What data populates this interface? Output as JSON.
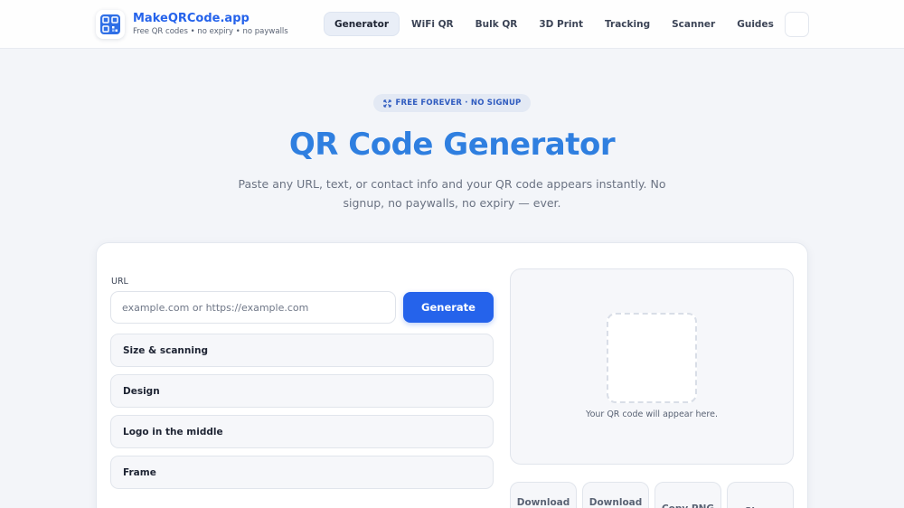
{
  "brand": {
    "name": "MakeQRCode.app",
    "tagline": "Free QR codes • no expiry • no paywalls",
    "logo_icon": "qr-logo-icon"
  },
  "nav": {
    "items": [
      {
        "label": "Generator",
        "active": true
      },
      {
        "label": "WiFi QR"
      },
      {
        "label": "Bulk QR"
      },
      {
        "label": "3D Print"
      },
      {
        "label": "Tracking"
      },
      {
        "label": "Scanner"
      },
      {
        "label": "Guides"
      }
    ]
  },
  "hero": {
    "badge": "FREE FOREVER · NO SIGNUP",
    "badge_icon": "expand-icon",
    "title": "QR Code Generator",
    "subtitle": "Paste any URL, text, or contact info and your QR code appears instantly. No signup, no paywalls, no expiry — ever."
  },
  "form": {
    "url_label": "URL",
    "url_placeholder": "example.com or https://example.com",
    "url_value": "",
    "generate_label": "Generate",
    "sections": [
      {
        "label": "Size & scanning"
      },
      {
        "label": "Design"
      },
      {
        "label": "Logo in the middle"
      },
      {
        "label": "Frame"
      }
    ]
  },
  "preview": {
    "placeholder_text": "Your QR code will appear here.",
    "actions": [
      {
        "label": "Download PNG"
      },
      {
        "label": "Download SVG"
      },
      {
        "label": "Copy PNG"
      },
      {
        "label": "Share"
      }
    ]
  },
  "colors": {
    "accent": "#2563eb",
    "title": "#2f7fe0",
    "background": "#f3f5f9"
  }
}
